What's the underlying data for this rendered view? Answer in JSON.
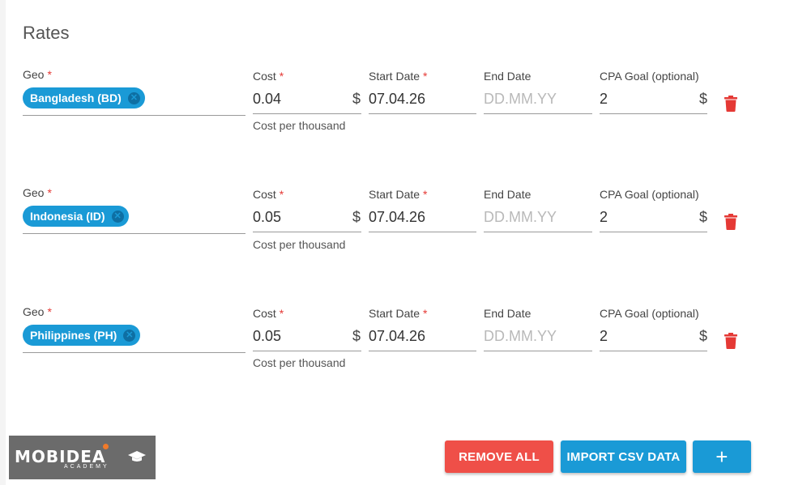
{
  "section": {
    "title": "Rates"
  },
  "fields": {
    "geo_label": "Geo",
    "cost_label": "Cost",
    "start_label": "Start Date",
    "end_label": "End Date",
    "cpa_label": "CPA Goal (optional)",
    "required_mark": "*",
    "currency": "$",
    "end_placeholder": "DD.MM.YY",
    "cost_helper": "Cost per thousand"
  },
  "rates": [
    {
      "geo": "Bangladesh (BD)",
      "cost": "0.04",
      "start": "07.04.26",
      "end": "",
      "cpa": "2"
    },
    {
      "geo": "Indonesia (ID)",
      "cost": "0.05",
      "start": "07.04.26",
      "end": "",
      "cpa": "2"
    },
    {
      "geo": "Philippines (PH)",
      "cost": "0.05",
      "start": "07.04.26",
      "end": "",
      "cpa": "2"
    }
  ],
  "actions": {
    "remove_all": "REMOVE ALL",
    "import_csv": "IMPORT CSV DATA",
    "add": "+"
  },
  "logo": {
    "name": "MOBIDEA",
    "subtitle": "ACADEMY"
  },
  "icons": {
    "chip_remove": "close-circle-icon",
    "delete_row": "trash-icon",
    "logo_cap": "graduation-cap-icon"
  },
  "colors": {
    "accent": "#1a9ad6",
    "danger": "#ef4f48",
    "required": "#e53935",
    "trash": "#e53935"
  }
}
